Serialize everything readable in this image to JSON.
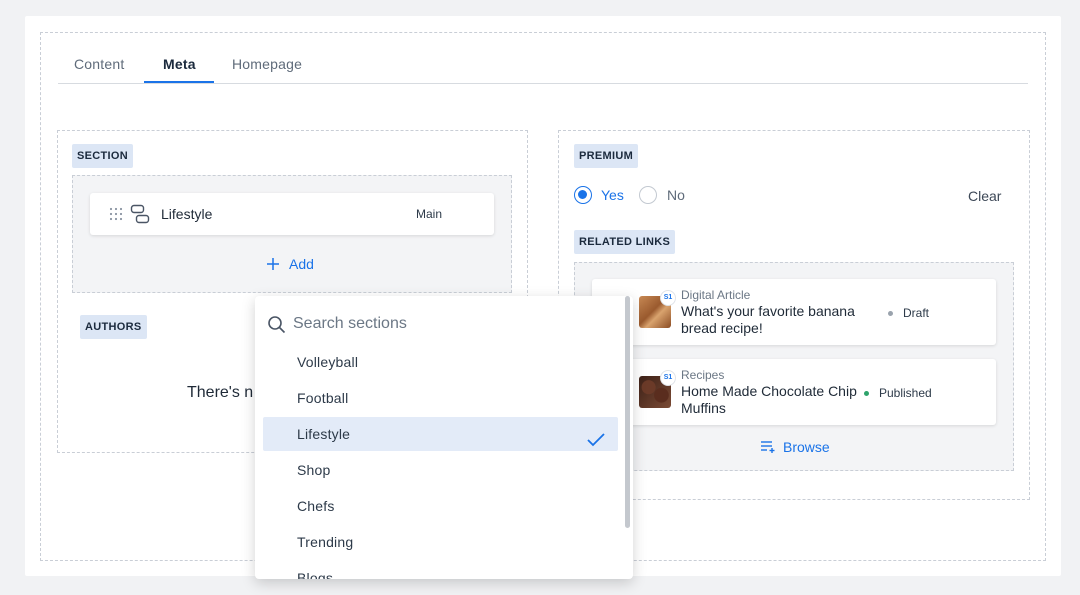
{
  "tabs": [
    {
      "label": "Content"
    },
    {
      "label": "Meta"
    },
    {
      "label": "Homepage"
    }
  ],
  "section": {
    "chip": "SECTION",
    "item": {
      "name": "Lifestyle",
      "tag": "Main"
    },
    "add_label": "Add"
  },
  "authors": {
    "chip": "AUTHORS",
    "empty_text": "There's n"
  },
  "premium": {
    "chip": "PREMIUM",
    "yes_label": "Yes",
    "no_label": "No",
    "selected": "Yes",
    "clear_label": "Clear"
  },
  "related_links": {
    "chip": "RELATED LINKS",
    "items": [
      {
        "type": "Digital Article",
        "title": "What's your favorite banana bread recipe!",
        "status": "Draft",
        "status_color": "#9aa3ad",
        "badge": "S1"
      },
      {
        "type": "Recipes",
        "title": "Home Made Chocolate Chip Muffins",
        "status": "Published",
        "status_color": "#2ea36b",
        "badge": "S1"
      }
    ],
    "browse_label": "Browse"
  },
  "dropdown": {
    "placeholder": "Search sections",
    "items": [
      {
        "label": "Volleyball"
      },
      {
        "label": "Football"
      },
      {
        "label": "Lifestyle"
      },
      {
        "label": "Shop"
      },
      {
        "label": "Chefs"
      },
      {
        "label": "Trending"
      },
      {
        "label": "Blogs"
      }
    ],
    "selected": "Lifestyle"
  },
  "colors": {
    "accent": "#1a73e8",
    "chip_bg": "#dce6f5",
    "selected_bg": "#e3ebf8"
  }
}
